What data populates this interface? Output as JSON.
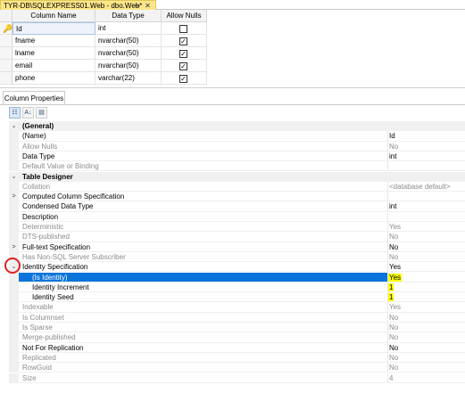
{
  "tab": {
    "title": "TYR-DB\\SQLEXPRESS01.Web - dbo.Web*",
    "pin_icon": "pin-icon",
    "close_icon": "close-icon"
  },
  "columns_grid": {
    "headers": [
      "Column Name",
      "Data Type",
      "Allow Nulls"
    ],
    "rows": [
      {
        "name": "Id",
        "type": "int",
        "allow_nulls": false,
        "primary_key": true
      },
      {
        "name": "fname",
        "type": "nvarchar(50)",
        "allow_nulls": true
      },
      {
        "name": "lname",
        "type": "nvarchar(50)",
        "allow_nulls": true
      },
      {
        "name": "email",
        "type": "nvarchar(50)",
        "allow_nulls": true
      },
      {
        "name": "phone",
        "type": "varchar(22)",
        "allow_nulls": true
      }
    ]
  },
  "properties_panel": {
    "tab_label": "Column Properties",
    "toolbar": [
      "categorized-icon",
      "alphabetical-icon",
      "property-pages-icon"
    ],
    "rows": [
      {
        "kind": "category",
        "expander": "⌄",
        "name": "(General)",
        "value": ""
      },
      {
        "kind": "prop",
        "name": "(Name)",
        "value": "Id"
      },
      {
        "kind": "prop",
        "dim": true,
        "name": "Allow Nulls",
        "value": "No"
      },
      {
        "kind": "prop",
        "name": "Data Type",
        "value": "int"
      },
      {
        "kind": "prop",
        "dim": true,
        "name": "Default Value or Binding",
        "value": ""
      },
      {
        "kind": "category",
        "expander": "⌄",
        "name": "Table Designer",
        "value": ""
      },
      {
        "kind": "prop",
        "dim": true,
        "name": "Collation",
        "value": "<database default>"
      },
      {
        "kind": "prop",
        "expander": ">",
        "name": "Computed Column Specification",
        "value": ""
      },
      {
        "kind": "prop",
        "name": "Condensed Data Type",
        "value": "int"
      },
      {
        "kind": "prop",
        "name": "Description",
        "value": ""
      },
      {
        "kind": "prop",
        "dim": true,
        "name": "Deterministic",
        "value": "Yes"
      },
      {
        "kind": "prop",
        "dim": true,
        "name": "DTS-published",
        "value": "No"
      },
      {
        "kind": "prop",
        "expander": ">",
        "name": "Full-text Specification",
        "value": "No"
      },
      {
        "kind": "prop",
        "dim": true,
        "name": "Has Non-SQL Server Subscriber",
        "value": "No"
      },
      {
        "kind": "prop",
        "expander": "⌄",
        "name": "Identity Specification",
        "value": "Yes"
      },
      {
        "kind": "child",
        "selected": true,
        "name": "(Is Identity)",
        "value": "Yes",
        "highlight": true
      },
      {
        "kind": "child",
        "name": "Identity Increment",
        "value": "1",
        "highlight": true
      },
      {
        "kind": "child",
        "name": "Identity Seed",
        "value": "1",
        "highlight": true
      },
      {
        "kind": "prop",
        "dim": true,
        "name": "Indexable",
        "value": "Yes"
      },
      {
        "kind": "prop",
        "dim": true,
        "name": "Is Columnset",
        "value": "No"
      },
      {
        "kind": "prop",
        "dim": true,
        "name": "Is Sparse",
        "value": "No"
      },
      {
        "kind": "prop",
        "dim": true,
        "name": "Merge-published",
        "value": "No"
      },
      {
        "kind": "prop",
        "name": "Not For Replication",
        "value": "No"
      },
      {
        "kind": "prop",
        "dim": true,
        "name": "Replicated",
        "value": "No"
      },
      {
        "kind": "prop",
        "dim": true,
        "name": "RowGuid",
        "value": "No"
      },
      {
        "kind": "prop",
        "dim": true,
        "name": "Size",
        "value": "4"
      }
    ]
  },
  "colors": {
    "selection": "#0a74da",
    "tab_background": "#fde68a",
    "highlight": "#ffff00",
    "annotation": "#e02020"
  }
}
